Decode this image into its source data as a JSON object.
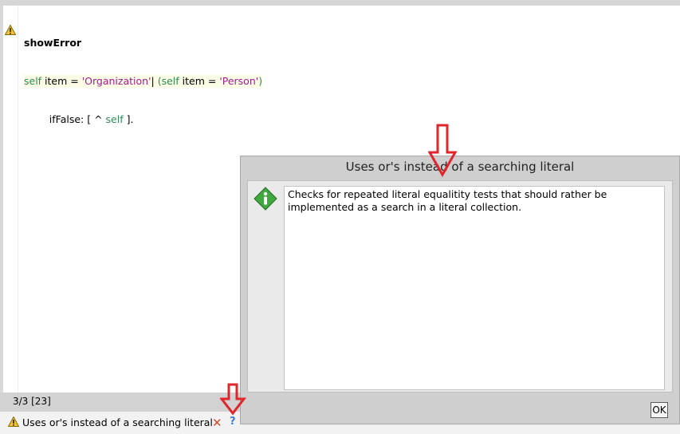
{
  "editor": {
    "selector": "showError",
    "line2": {
      "kw1": "self",
      "t1": " item = ",
      "s1": "'Organization'",
      "t2": "| ",
      "p1": "(",
      "kw2": "self",
      "t3": " item = ",
      "s2": "'Person'",
      "p2": ")"
    },
    "line3": {
      "indent": "        ",
      "t1": "ifFalse: [ ^ ",
      "kw": "self",
      "t2": " ]."
    }
  },
  "status": {
    "position": "3/3 [23]"
  },
  "critique": {
    "label": "Uses or's instead of a searching literal",
    "dismiss_icon": "close-icon",
    "help_icon": "help-icon",
    "help_glyph": "?"
  },
  "dialog": {
    "title": "Uses or's instead of a searching literal",
    "body": "Checks for repeated literal equalitity tests that should rather be implemented as a search in a literal collection.",
    "ok_label": "OK",
    "icon": "info-icon"
  },
  "colors": {
    "keyword": "#2e8b57",
    "string": "#a0208a",
    "annotation_arrow": "#e0262b"
  }
}
